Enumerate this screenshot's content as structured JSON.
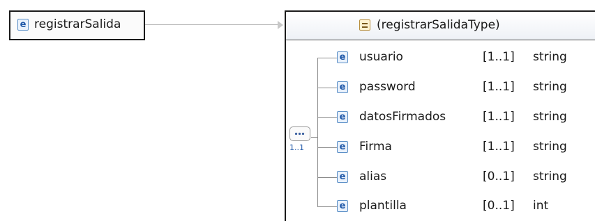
{
  "root_element": {
    "badge": "e",
    "name": "registrarSalida"
  },
  "complex_type": {
    "name": "(registrarSalidaType)",
    "icon": "complex-type-icon"
  },
  "sequence": {
    "icon": "sequence-icon",
    "occurrence": "1..1"
  },
  "children": [
    {
      "badge": "e",
      "name": "usuario",
      "occurrence": "[1..1]",
      "type": "string"
    },
    {
      "badge": "e",
      "name": "password",
      "occurrence": "[1..1]",
      "type": "string"
    },
    {
      "badge": "e",
      "name": "datosFirmados",
      "occurrence": "[1..1]",
      "type": "string"
    },
    {
      "badge": "e",
      "name": "Firma",
      "occurrence": "[1..1]",
      "type": "string"
    },
    {
      "badge": "e",
      "name": "alias",
      "occurrence": "[0..1]",
      "type": "string"
    },
    {
      "badge": "e",
      "name": "plantilla",
      "occurrence": "[0..1]",
      "type": "int"
    }
  ]
}
